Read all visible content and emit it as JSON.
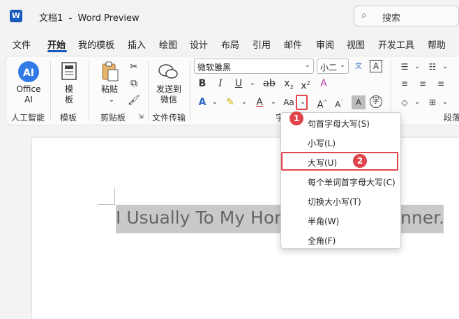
{
  "title": {
    "doc_name": "文档1",
    "separator": "-",
    "app": "Word Preview"
  },
  "search": {
    "placeholder": "搜索"
  },
  "tabs": [
    "文件",
    "开始",
    "我的模板",
    "插入",
    "绘图",
    "设计",
    "布局",
    "引用",
    "邮件",
    "审阅",
    "视图",
    "开发工具",
    "帮助"
  ],
  "ribbon": {
    "ai": {
      "label": "Office AI",
      "group": "人工智能"
    },
    "template": {
      "label": "模板",
      "group": "模板"
    },
    "clipboard": {
      "paste": "粘贴",
      "group": "剪贴板"
    },
    "transfer": {
      "label": "发送到微信",
      "group": "文件传输"
    },
    "font": {
      "name": "微软雅黑",
      "size": "小二",
      "case_button": "Aa",
      "group_partial": "字"
    },
    "paragraph": {
      "group_partial": "段落"
    }
  },
  "document": {
    "visible_text_left": "I Usually To My Hom",
    "visible_text_right": "nner."
  },
  "case_menu": {
    "items": [
      "句首字母大写(S)",
      "小写(L)",
      "大写(U)",
      "每个单词首字母大写(C)",
      "切换大小写(T)",
      "半角(W)",
      "全角(F)"
    ]
  },
  "annotations": {
    "step1": "1",
    "step2": "2"
  },
  "colors": {
    "accent": "#185abd",
    "callout": "#e0444c",
    "selection": "#c9c9c9"
  }
}
